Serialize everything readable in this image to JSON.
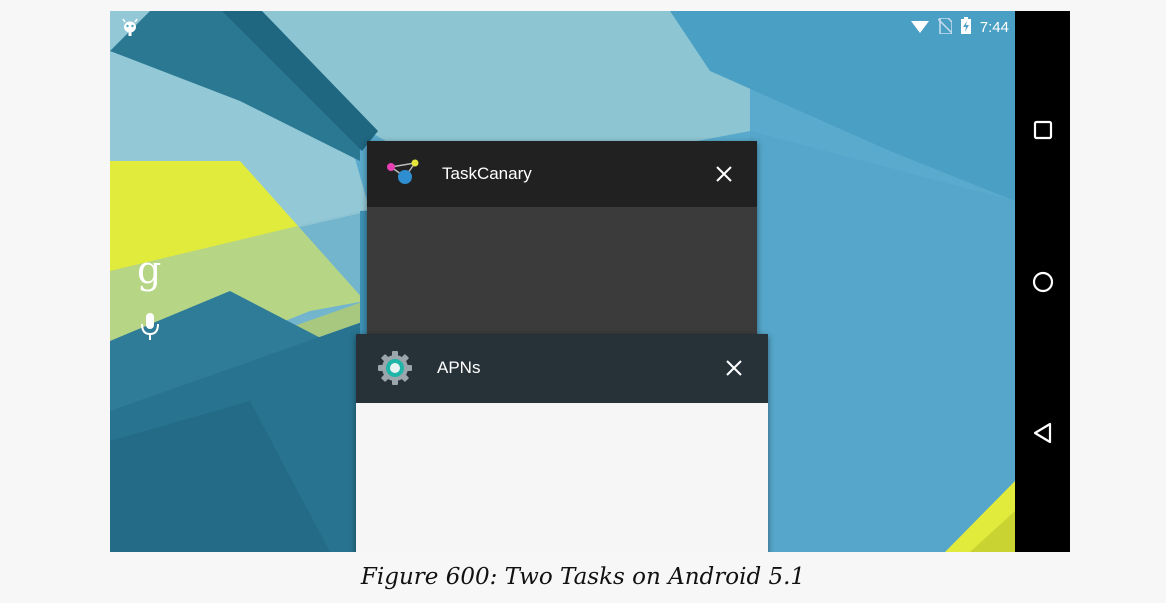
{
  "status_bar": {
    "time": "7:44",
    "left_icon": "android-debug-icon",
    "right_icons": [
      "wifi-icon",
      "no-sim-icon",
      "battery-charging-icon"
    ]
  },
  "home": {
    "search_icon": "google-g-icon",
    "voice_icon": "microphone-icon"
  },
  "recents": {
    "tasks": [
      {
        "title": "TaskCanary",
        "icon": "taskcanary-app-icon",
        "close_icon": "close-icon"
      },
      {
        "title": "APNs",
        "icon": "settings-gear-icon",
        "close_icon": "close-icon"
      }
    ]
  },
  "nav_bar": {
    "buttons": [
      "recents-square-icon",
      "home-circle-icon",
      "back-triangle-icon"
    ]
  },
  "caption": "Figure 600: Two Tasks on Android 5.1",
  "colors": {
    "wallpaper_blue": "#4fa3c7",
    "wallpaper_teal": "#2f7b96",
    "wallpaper_yellow": "#e2ec3a",
    "taskcanary_header": "#212121",
    "apns_header": "#263238"
  }
}
